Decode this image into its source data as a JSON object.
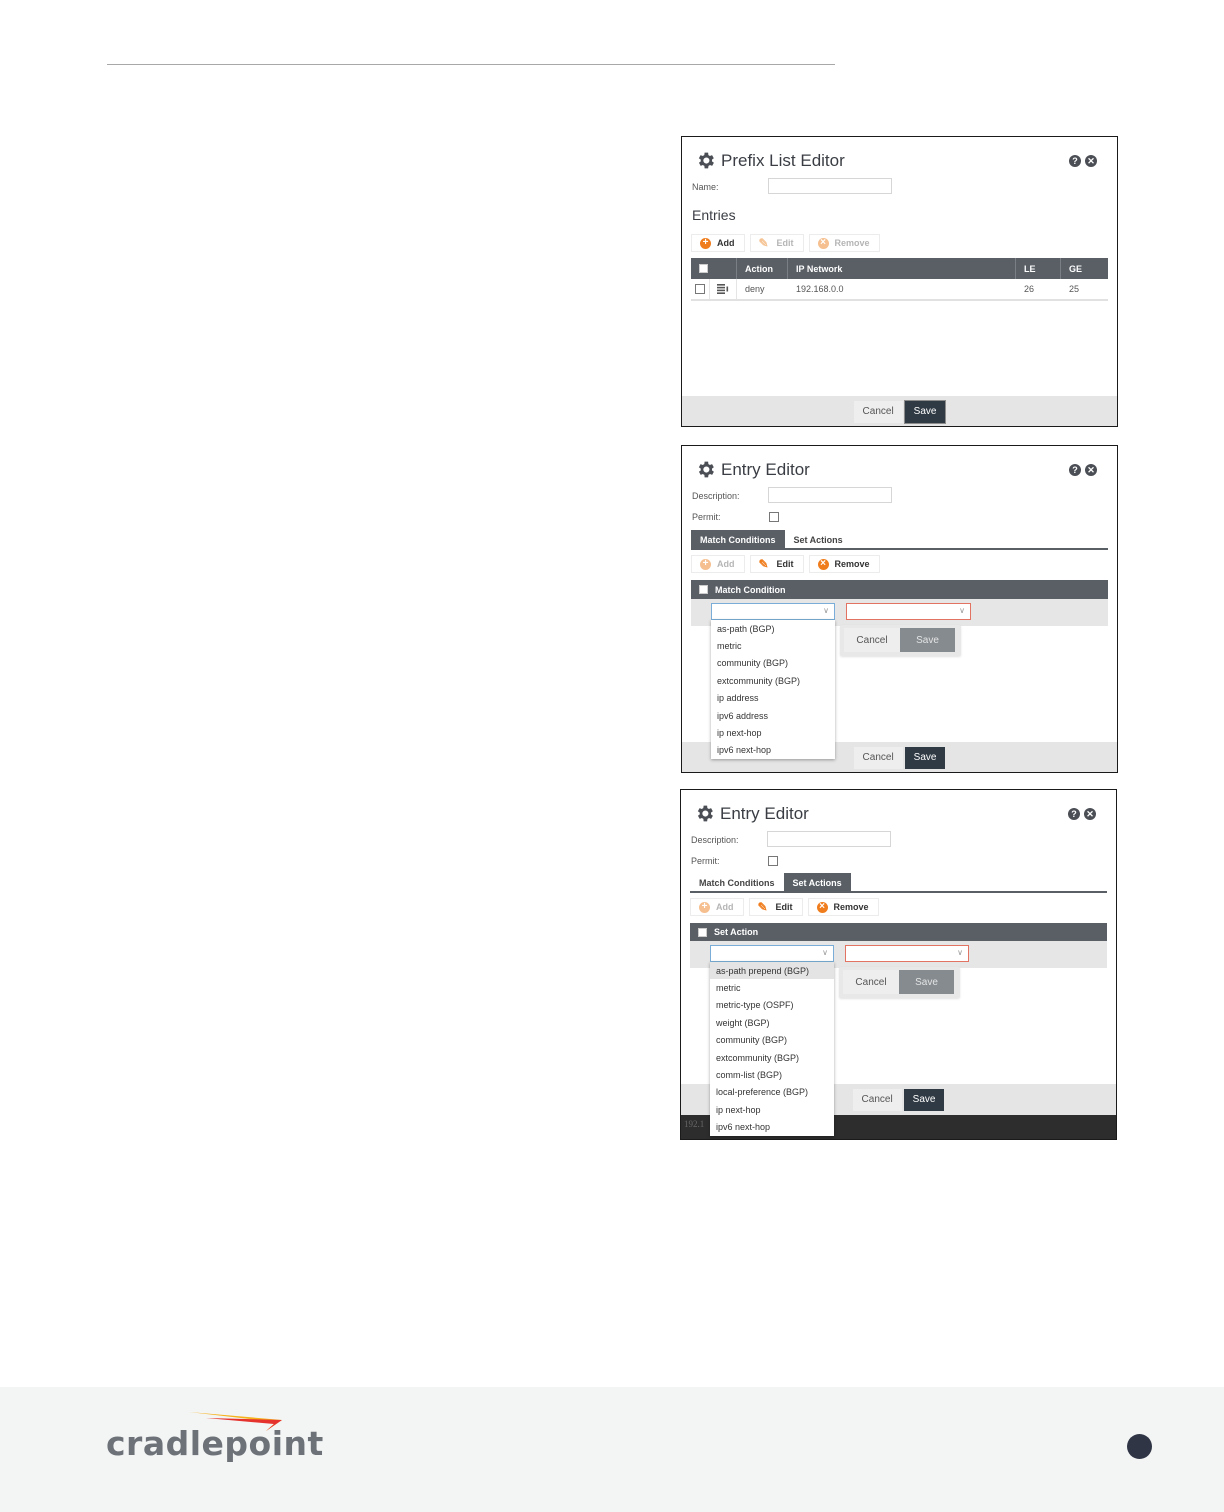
{
  "brand": {
    "name": "cradlepoint",
    "accent_yellow": "#f6b21b",
    "accent_red": "#e5322d",
    "text_color": "#6d7278"
  },
  "prefix_list_editor": {
    "title": "Prefix List Editor",
    "icons": [
      "gear-icon",
      "help-icon",
      "close-icon"
    ],
    "help_glyph": "?",
    "close_glyph": "✕",
    "name_label": "Name:",
    "name_value": "",
    "entries_heading": "Entries",
    "toolbar": {
      "add": "Add",
      "edit": "Edit",
      "remove": "Remove"
    },
    "table": {
      "columns": [
        "",
        "",
        "Action",
        "IP Network",
        "LE",
        "GE"
      ],
      "rows": [
        {
          "action": "deny",
          "ip_network": "192.168.0.0",
          "le": "26",
          "ge": "25"
        }
      ]
    },
    "footer": {
      "cancel": "Cancel",
      "save": "Save"
    }
  },
  "entry_editor_match": {
    "title": "Entry Editor",
    "description_label": "Description:",
    "description_value": "",
    "permit_label": "Permit:",
    "permit_checked": false,
    "tabs": [
      {
        "label": "Match Conditions",
        "active": true
      },
      {
        "label": "Set Actions",
        "active": false
      }
    ],
    "toolbar": {
      "add": "Add",
      "edit": "Edit",
      "remove": "Remove"
    },
    "grid_header": "Match Condition",
    "inline": {
      "cancel": "Cancel",
      "save": "Save"
    },
    "dropdown_options": [
      "as-path (BGP)",
      "metric",
      "community (BGP)",
      "extcommunity (BGP)",
      "ip address",
      "ipv6 address",
      "ip next-hop",
      "ipv6 next-hop"
    ],
    "footer": {
      "cancel": "Cancel",
      "save": "Save"
    }
  },
  "entry_editor_set": {
    "title": "Entry Editor",
    "description_label": "Description:",
    "description_value": "",
    "permit_label": "Permit:",
    "permit_checked": false,
    "tabs": [
      {
        "label": "Match Conditions",
        "active": false
      },
      {
        "label": "Set Actions",
        "active": true
      }
    ],
    "toolbar": {
      "add": "Add",
      "edit": "Edit",
      "remove": "Remove"
    },
    "grid_header": "Set Action",
    "inline": {
      "cancel": "Cancel",
      "save": "Save"
    },
    "dropdown_options": [
      "as-path prepend (BGP)",
      "metric",
      "metric-type (OSPF)",
      "weight (BGP)",
      "community (BGP)",
      "extcommunity (BGP)",
      "comm-list (BGP)",
      "local-preference (BGP)",
      "ip next-hop",
      "ipv6 next-hop"
    ],
    "dropdown_highlighted": "as-path prepend (BGP)",
    "footer": {
      "cancel": "Cancel",
      "save": "Save"
    },
    "background_text": "192.1"
  }
}
